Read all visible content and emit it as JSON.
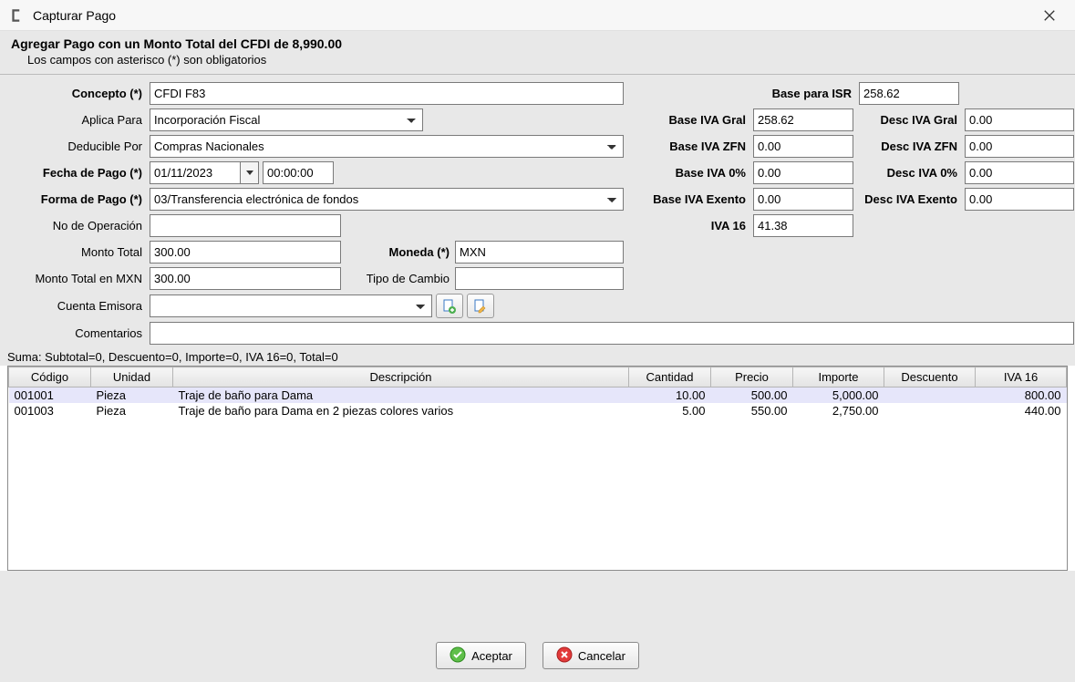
{
  "window": {
    "title": "Capturar Pago"
  },
  "header": {
    "line1": "Agregar Pago con un Monto Total del CFDI de 8,990.00",
    "line2": "Los campos con asterisco (*) son obligatorios"
  },
  "labels": {
    "concepto": "Concepto (*)",
    "aplica_para": "Aplica Para",
    "deducible_por": "Deducible Por",
    "fecha_pago": "Fecha de Pago (*)",
    "forma_pago": "Forma de Pago (*)",
    "no_operacion": "No de Operación",
    "monto_total": "Monto Total",
    "moneda": "Moneda (*)",
    "monto_total_mxn": "Monto Total en MXN",
    "tipo_cambio": "Tipo de Cambio",
    "cuenta_emisora": "Cuenta Emisora",
    "comentarios": "Comentarios",
    "base_isr": "Base para ISR",
    "base_iva_gral": "Base IVA Gral",
    "desc_iva_gral": "Desc IVA Gral",
    "base_iva_zfn": "Base IVA ZFN",
    "desc_iva_zfn": "Desc IVA ZFN",
    "base_iva_0": "Base IVA 0%",
    "desc_iva_0": "Desc IVA 0%",
    "base_iva_exento": "Base IVA Exento",
    "desc_iva_exento": "Desc IVA Exento",
    "iva_16": "IVA 16"
  },
  "values": {
    "concepto": "CFDI F83",
    "aplica_para": "Incorporación Fiscal",
    "deducible_por": "Compras Nacionales",
    "fecha_pago": "01/11/2023",
    "hora_pago": "00:00:00",
    "forma_pago": "03/Transferencia electrónica de fondos",
    "no_operacion": "",
    "monto_total": "300.00",
    "moneda": "MXN",
    "monto_total_mxn": "300.00",
    "tipo_cambio": "",
    "cuenta_emisora": "",
    "comentarios": "",
    "base_isr": "258.62",
    "base_iva_gral": "258.62",
    "desc_iva_gral": "0.00",
    "base_iva_zfn": "0.00",
    "desc_iva_zfn": "0.00",
    "base_iva_0": "0.00",
    "desc_iva_0": "0.00",
    "base_iva_exento": "0.00",
    "desc_iva_exento": "0.00",
    "iva_16": "41.38"
  },
  "summary": "Suma:  Subtotal=0, Descuento=0, Importe=0, IVA 16=0, Total=0",
  "table": {
    "headers": {
      "codigo": "Código",
      "unidad": "Unidad",
      "descripcion": "Descripción",
      "cantidad": "Cantidad",
      "precio": "Precio",
      "importe": "Importe",
      "descuento": "Descuento",
      "iva16": "IVA 16"
    },
    "rows": [
      {
        "codigo": "001001",
        "unidad": "Pieza",
        "descripcion": "Traje de baño para Dama",
        "cantidad": "10.00",
        "precio": "500.00",
        "importe": "5,000.00",
        "descuento": "",
        "iva16": "800.00"
      },
      {
        "codigo": "001003",
        "unidad": "Pieza",
        "descripcion": "Traje de baño para Dama en 2 piezas colores varios",
        "cantidad": "5.00",
        "precio": "550.00",
        "importe": "2,750.00",
        "descuento": "",
        "iva16": "440.00"
      }
    ]
  },
  "buttons": {
    "aceptar": "Aceptar",
    "cancelar": "Cancelar"
  }
}
